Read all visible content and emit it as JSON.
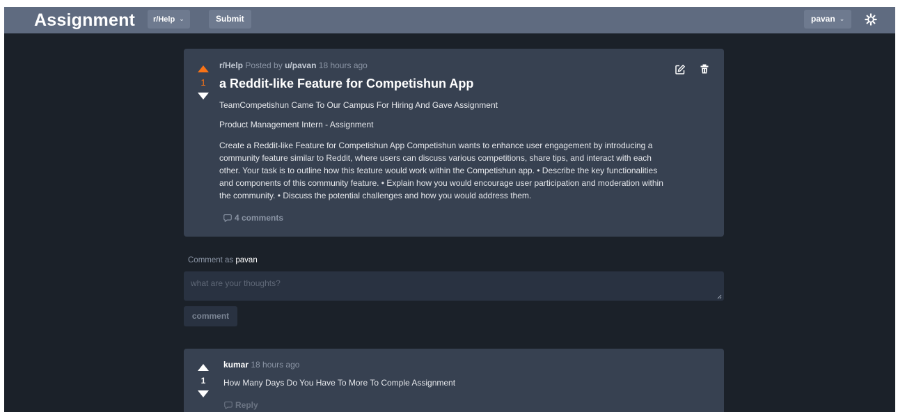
{
  "header": {
    "brand": "Assignment",
    "subreddit_selector": "r/Help",
    "submit_label": "Submit",
    "user_menu": "pavan",
    "theme_icon": "gear-icon"
  },
  "post": {
    "votes": "1",
    "subreddit": "r/Help",
    "posted_by_prefix": "Posted by",
    "author": "u/pavan",
    "time": "18 hours ago",
    "title": "a Reddit-like Feature for Competishun App",
    "line1": "TeamCompetishun Came To Our Campus For Hiring And Gave Assignment",
    "line2": "Product Management Intern - Assignment",
    "body": "Create a Reddit-like Feature for Competishun App Competishun wants to enhance user engagement by introducing a community feature similar to Reddit, where users can discuss various competitions, share tips, and interact with each other. Your task is to outline how this feature would work within the Competishun app. • Describe the key functionalities and components of this community feature. • Explain how you would encourage user participation and moderation within the community. • Discuss the potential challenges and how you would address them.",
    "comments_count": "4 comments",
    "accent": "#f97316"
  },
  "comment_form": {
    "label_prefix": "Comment as",
    "username": "pavan",
    "placeholder": "what are your thoughts?",
    "submit_label": "comment"
  },
  "comments": [
    {
      "author": "kumar",
      "time": "18 hours ago",
      "votes": "1",
      "body": "How Many Days Do You Have To More To Comple Assignment",
      "reply_label": "Reply"
    }
  ]
}
